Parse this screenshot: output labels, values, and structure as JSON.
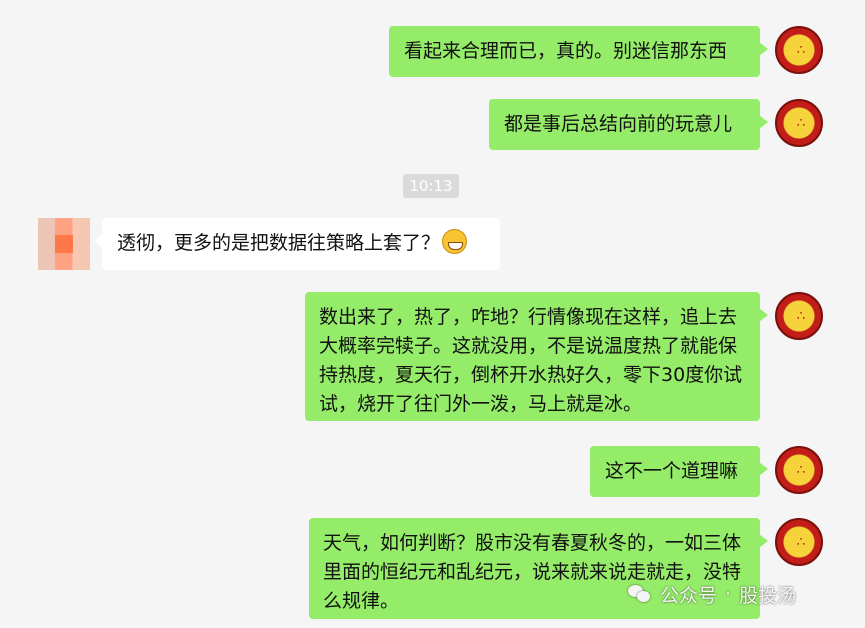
{
  "conversation": {
    "messages": [
      {
        "sender": "self",
        "text": "看起来合理而已，真的。别迷信那东西"
      },
      {
        "sender": "self",
        "text": "都是事后总结向前的玩意儿"
      },
      {
        "sender": "other",
        "text": "透彻，更多的是把数据往策略上套了？",
        "emoji": "grin-icon"
      },
      {
        "sender": "self",
        "text": "数出来了，热了，咋地？行情像现在这样，追上去大概率完犊子。这就没用，不是说温度热了就能保持热度，夏天行，倒杯开水热好久，零下30度你试试，烧开了往门外一泼，马上就是冰。"
      },
      {
        "sender": "self",
        "text": "这不一个道理嘛"
      },
      {
        "sender": "self",
        "text": "天气，如何判断？股市没有春夏秋冬的，一如三体里面的恒纪元和乱纪元，说来就来说走就走，没特么规律。"
      }
    ],
    "timestamp": "10:13"
  },
  "watermark": {
    "prefix": "公众号",
    "separator": "·",
    "name": "股投汤"
  },
  "colors": {
    "self_bubble": "#95ec69",
    "other_bubble": "#ffffff",
    "background": "#f5f5f5"
  }
}
